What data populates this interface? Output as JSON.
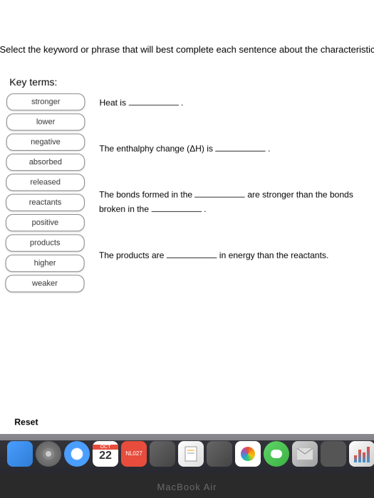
{
  "instruction": "Select the keyword or phrase that will best complete each sentence about the characteristics of e",
  "keyTermsTitle": "Key terms:",
  "terms": [
    "stronger",
    "lower",
    "negative",
    "absorbed",
    "released",
    "reactants",
    "positive",
    "products",
    "higher",
    "weaker"
  ],
  "sentences": {
    "s1_pre": "Heat is ",
    "s1_post": " .",
    "s2_pre": "The enthalphy change (ΔH) is ",
    "s2_post": " .",
    "s3_pre": "The bonds formed in the ",
    "s3_mid": " are stronger than the bonds broken in the ",
    "s3_post": " .",
    "s4_pre": "The products are ",
    "s4_post": " in energy than the reactants."
  },
  "resetLabel": "Reset",
  "calendar": {
    "header": "OCT",
    "day": "22"
  },
  "tagLabel": "NL027",
  "laptopLabel": "MacBook Air"
}
